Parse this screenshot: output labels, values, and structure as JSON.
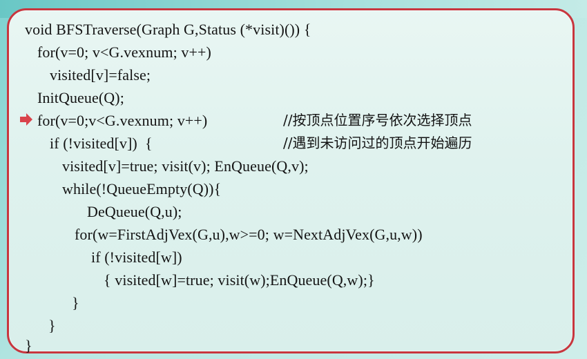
{
  "code": {
    "lines": [
      "void BFSTraverse(Graph G,Status (*visit)()) {",
      "for(v=0; v<G.vexnum; v++)",
      "visited[v]=false;",
      "InitQueue(Q);",
      "for(v=0;v<G.vexnum; v++)",
      "if (!visited[v])  {",
      "visited[v]=true; visit(v); EnQueue(Q,v);",
      "while(!QueueEmpty(Q)){",
      "DeQueue(Q,u);",
      "for(w=FirstAdjVex(G,u),w>=0; w=NextAdjVex(G,u,w))",
      "if (!visited[w])",
      "{ visited[w]=true; visit(w);EnQueue(Q,w);}",
      "}",
      "}",
      "}"
    ],
    "comments": {
      "line5": "//按顶点位置序号依次选择顶点",
      "line6": "//遇到未访问过的顶点开始遍历"
    }
  },
  "colors": {
    "border": "#c8363e",
    "arrow": "#d9434b",
    "text": "#141414"
  },
  "icons": {
    "current_line_marker": "arrow-right-icon"
  }
}
